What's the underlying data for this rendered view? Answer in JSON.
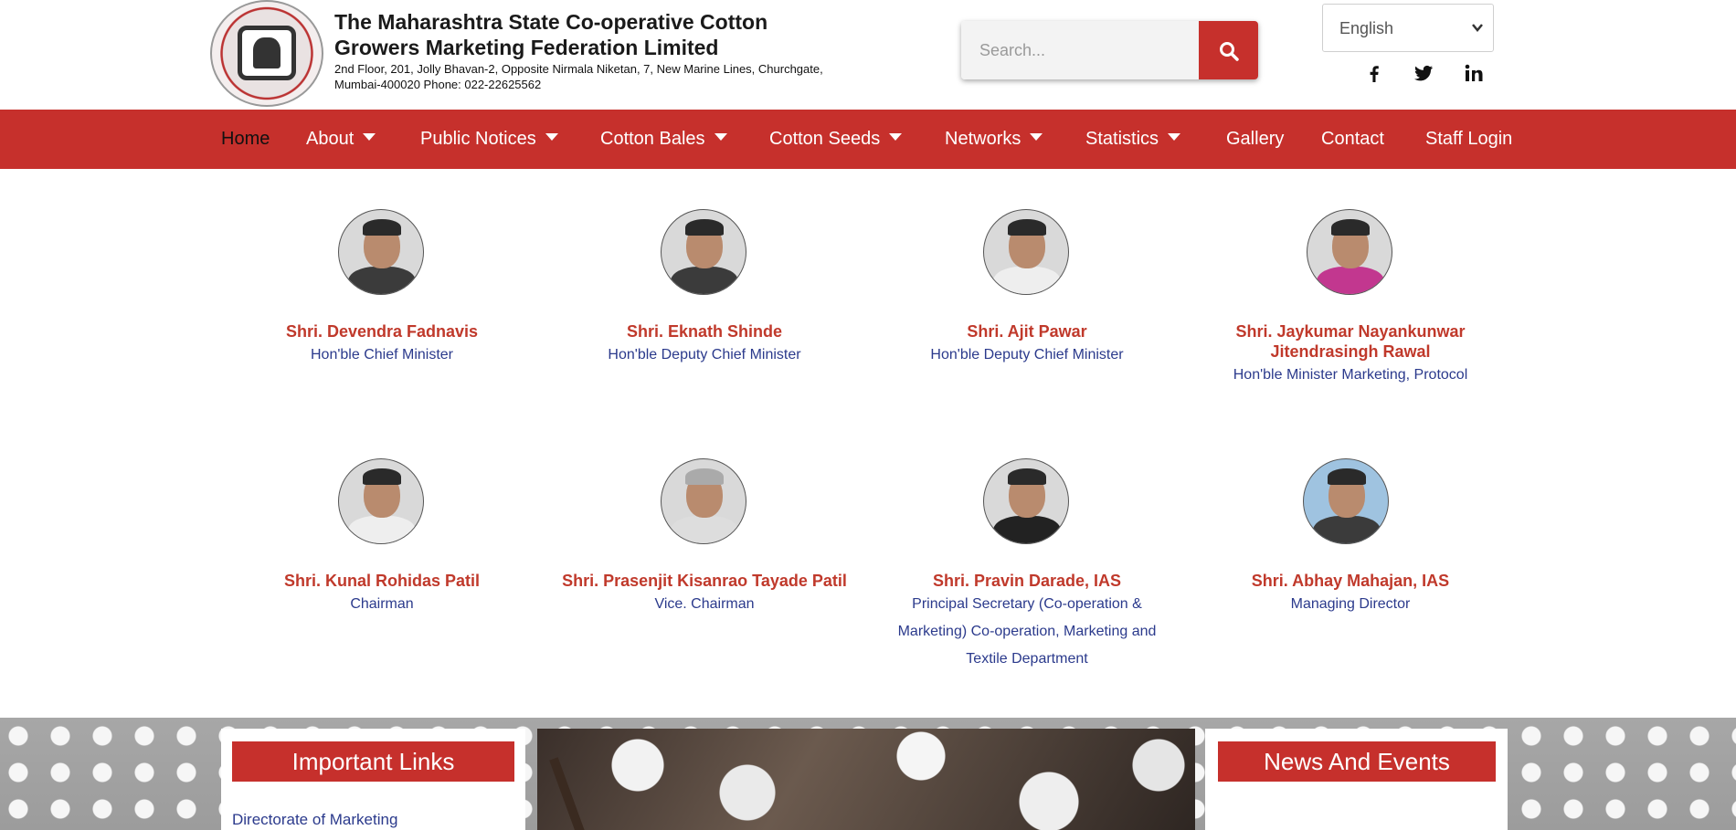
{
  "header": {
    "org_name": "The Maharashtra State Co-operative Cotton Growers Marketing Federation Limited",
    "address": "2nd Floor, 201, Jolly Bhavan-2, Opposite Nirmala Niketan, 7, New Marine Lines, Churchgate, Mumbai-400020 Phone: 022-22625562",
    "search_placeholder": "Search...",
    "language": "English"
  },
  "nav": {
    "items": [
      {
        "label": "Home"
      },
      {
        "label": "About"
      },
      {
        "label": "Public Notices"
      },
      {
        "label": "Cotton Bales"
      },
      {
        "label": "Cotton Seeds"
      },
      {
        "label": "Networks"
      },
      {
        "label": "Statistics"
      },
      {
        "label": "Gallery"
      },
      {
        "label": "Contact"
      },
      {
        "label": "Staff Login"
      }
    ]
  },
  "people": [
    {
      "name": "Shri. Devendra Fadnavis",
      "title": "Hon'ble Chief Minister"
    },
    {
      "name": "Shri. Eknath Shinde",
      "title": "Hon'ble Deputy Chief Minister"
    },
    {
      "name": "Shri. Ajit Pawar",
      "title": "Hon'ble Deputy Chief Minister"
    },
    {
      "name": "Shri. Jaykumar Nayankunwar Jitendrasingh Rawal",
      "title": "Hon'ble Minister Marketing, Protocol"
    },
    {
      "name": "Shri. Kunal Rohidas Patil",
      "title": "Chairman"
    },
    {
      "name": "Shri. Prasenjit Kisanrao Tayade Patil",
      "title": "Vice. Chairman"
    },
    {
      "name": "Shri. Pravin Darade, IAS",
      "title": "Principal Secretary (Co-operation & Marketing) Co-operation, Marketing and Textile Department"
    },
    {
      "name": "Shri. Abhay Mahajan, IAS",
      "title": "Managing Director"
    }
  ],
  "important_links": {
    "heading": "Important Links",
    "items": [
      "Directorate of Marketing"
    ]
  },
  "news": {
    "heading": "News And Events"
  },
  "colors": {
    "brand_red": "#c6302c",
    "name_red": "#c0392b",
    "title_blue": "#2b3a8c"
  },
  "icons": [
    "search-icon",
    "facebook-icon",
    "twitter-icon",
    "linkedin-icon",
    "chevron-down-icon",
    "caret-down-icon"
  ]
}
